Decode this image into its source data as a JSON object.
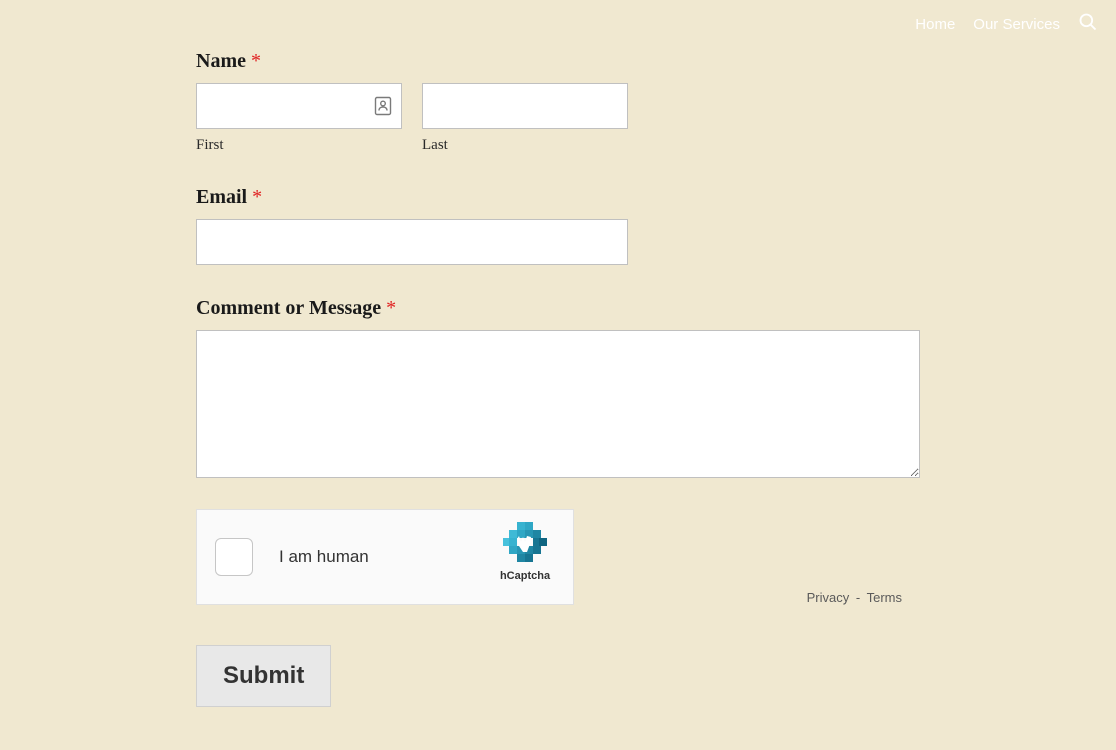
{
  "topbar": {
    "nav1": "Home",
    "nav2": "Our Services"
  },
  "form": {
    "name_label": "Name",
    "first_sublabel": "First",
    "last_sublabel": "Last",
    "email_label": "Email",
    "message_label": "Comment or Message",
    "required_mark": "*",
    "submit_label": "Submit"
  },
  "captcha": {
    "text": "I am human",
    "brand": "hCaptcha",
    "privacy": "Privacy",
    "sep": "-",
    "terms": "Terms"
  }
}
